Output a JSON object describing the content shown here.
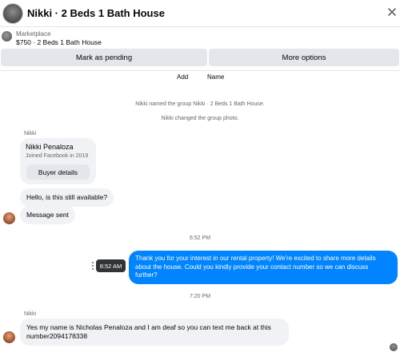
{
  "header": {
    "title": "Nikki · 2 Beds 1 Bath House",
    "close_icon": "close-icon"
  },
  "marketplace": {
    "label": "Marketplace",
    "listing": "$750 · 2 Beds 1 Bath House"
  },
  "actions": {
    "pending_label": "Mark as pending",
    "more_label": "More options"
  },
  "tabs": {
    "add": "Add",
    "name": "Name"
  },
  "system_messages": [
    "Nikki named the group Nikki · 2 Beds 1 Bath House.",
    "Nikki changed the group photo."
  ],
  "thread": {
    "sender_1": "Nikki",
    "card": {
      "name": "Nikki Penaloza",
      "joined": "Joined Facebook in 2019",
      "button": "Buyer details"
    },
    "msg_1": "Hello, is this still available?",
    "msg_2": "Message sent",
    "time_1": "6:52 PM",
    "outgoing": "Thank you for your interest in our rental property! We're excited to share more details about the house. Could you kindly provide your contact number so we can discuss further?",
    "tooltip_time": "8:52 AM",
    "time_2": "7:20 PM",
    "sender_2": "Nikki",
    "msg_3": "Yes my name is Nicholas Penaloza and I am deaf so you can text me back at this number2094178338"
  },
  "colors": {
    "outgoing_bubble": "#0084ff",
    "incoming_bubble": "#f0f2f5",
    "button_bg": "#e4e6eb",
    "secondary_text": "#65676b"
  }
}
